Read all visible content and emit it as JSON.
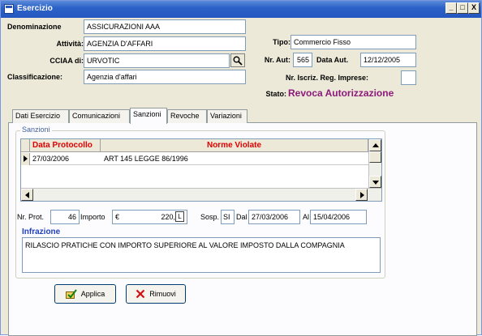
{
  "window": {
    "title": "Esercizio",
    "controls": [
      "_",
      "□",
      "X"
    ]
  },
  "header": {
    "denominazione": {
      "label": "Denominazione",
      "value": "ASSICURAZIONI AAA"
    },
    "attivita": {
      "label": "Attività:",
      "value": "AGENZIA D'AFFARI"
    },
    "cciaa": {
      "label": "CCIAA di:",
      "value": "URVOTIC"
    },
    "classificazione": {
      "label": "Classificazione:",
      "value": "Agenzia d'affari"
    },
    "tipo": {
      "label": "Tipo:",
      "value": "Commercio Fisso"
    },
    "nr_aut": {
      "label": "Nr. Aut:",
      "value": "565"
    },
    "data_aut": {
      "label": "Data Aut.",
      "value": "12/12/2005"
    },
    "nr_iscriz": {
      "label": "Nr. Iscriz. Reg. Imprese:",
      "value": ""
    },
    "stato": {
      "label": "Stato:",
      "value": "Revoca Autorizzazione"
    }
  },
  "tabs": [
    {
      "label": "Dati Esercizio",
      "active": false
    },
    {
      "label": "Comunicazioni",
      "active": false
    },
    {
      "label": "Sanzioni",
      "active": true
    },
    {
      "label": "Revoche",
      "active": false
    },
    {
      "label": "Variazioni",
      "active": false
    }
  ],
  "sanzioni": {
    "group_label": "Sanzioni",
    "grid": {
      "columns": [
        "Data Protocollo",
        "Norme Violate"
      ],
      "rows": [
        {
          "data_protocollo": "27/03/2006",
          "norme_violate": "ART 145 LEGGE 86/1996"
        }
      ]
    },
    "nr_prot": {
      "label": "Nr. Prot.",
      "value": "46"
    },
    "importo": {
      "label": "Importo",
      "currency": "€",
      "value": "220,00",
      "unit": "L"
    },
    "sosp": {
      "label": "Sosp.",
      "value": "SI"
    },
    "dal": {
      "label": "Dal",
      "value": "27/03/2006"
    },
    "al": {
      "label": "Al",
      "value": "15/04/2006"
    },
    "infrazione": {
      "label": "Infrazione",
      "value": "RILASCIO PRATICHE CON IMPORTO SUPERIORE AL VALORE IMPOSTO DALLA COMPAGNIA"
    }
  },
  "buttons": {
    "applica": "Applica",
    "rimuovi": "Rimuovi"
  },
  "icons": {
    "search": "magnifier-icon",
    "applica": "apply-icon",
    "rimuovi": "remove-x-icon"
  }
}
